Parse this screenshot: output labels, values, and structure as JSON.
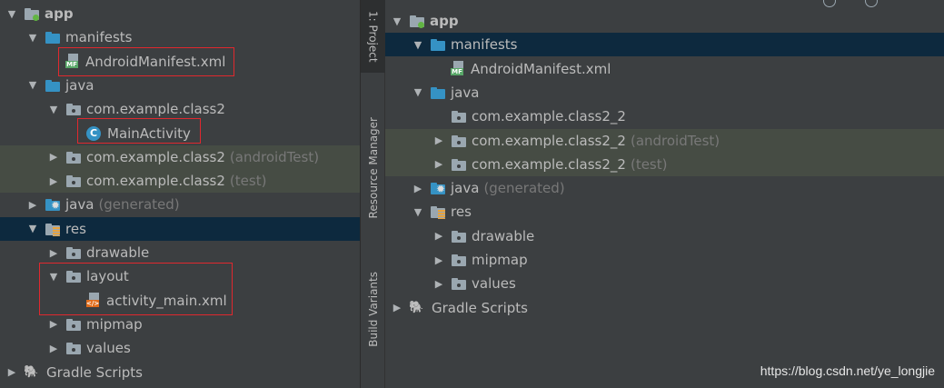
{
  "left_tree": [
    {
      "label": "app",
      "bold": true,
      "icon": "module-icon",
      "arrow": "down",
      "indent": 0,
      "hl": ""
    },
    {
      "label": "manifests",
      "icon": "folder-blue-icon",
      "arrow": "down",
      "indent": 1,
      "hl": ""
    },
    {
      "label": "AndroidManifest.xml",
      "icon": "manifest-file-icon",
      "arrow": "none",
      "indent": 2,
      "hl": ""
    },
    {
      "label": "java",
      "icon": "folder-blue-icon",
      "arrow": "down",
      "indent": 1,
      "hl": ""
    },
    {
      "label": "com.example.class2",
      "icon": "package-icon",
      "arrow": "down",
      "indent": 2,
      "hl": ""
    },
    {
      "label": "MainActivity",
      "icon": "class-icon",
      "arrow": "none",
      "indent": 3,
      "hl": ""
    },
    {
      "label": "com.example.class2",
      "suffix": "(androidTest)",
      "icon": "package-icon",
      "arrow": "right",
      "indent": 2,
      "hl": "green"
    },
    {
      "label": "com.example.class2",
      "suffix": "(test)",
      "icon": "package-icon",
      "arrow": "right",
      "indent": 2,
      "hl": "green"
    },
    {
      "label": "java",
      "suffix": "(generated)",
      "icon": "generated-folder-icon",
      "arrow": "right",
      "indent": 1,
      "hl": ""
    },
    {
      "label": "res",
      "icon": "res-folder-icon",
      "arrow": "down",
      "indent": 1,
      "hl": "blue"
    },
    {
      "label": "drawable",
      "icon": "package-icon",
      "arrow": "right",
      "indent": 2,
      "hl": ""
    },
    {
      "label": "layout",
      "icon": "package-icon",
      "arrow": "down",
      "indent": 2,
      "hl": ""
    },
    {
      "label": "activity_main.xml",
      "icon": "layout-file-icon",
      "arrow": "none",
      "indent": 3,
      "hl": ""
    },
    {
      "label": "mipmap",
      "icon": "package-icon",
      "arrow": "right",
      "indent": 2,
      "hl": ""
    },
    {
      "label": "values",
      "icon": "package-icon",
      "arrow": "right",
      "indent": 2,
      "hl": ""
    },
    {
      "label": "Gradle Scripts",
      "icon": "gradle-icon",
      "arrow": "right",
      "indent": 0,
      "hl": ""
    }
  ],
  "right_tree": [
    {
      "label": "app",
      "bold": true,
      "icon": "module-icon",
      "arrow": "down",
      "indent": 0,
      "hl": ""
    },
    {
      "label": "manifests",
      "icon": "folder-blue-icon",
      "arrow": "down",
      "indent": 1,
      "hl": "blue"
    },
    {
      "label": "AndroidManifest.xml",
      "icon": "manifest-file-icon",
      "arrow": "none",
      "indent": 2,
      "hl": ""
    },
    {
      "label": "java",
      "icon": "folder-blue-icon",
      "arrow": "down",
      "indent": 1,
      "hl": ""
    },
    {
      "label": "com.example.class2_2",
      "icon": "package-icon",
      "arrow": "none",
      "indent": 2,
      "hl": ""
    },
    {
      "label": "com.example.class2_2",
      "suffix": "(androidTest)",
      "icon": "package-icon",
      "arrow": "right",
      "indent": 2,
      "hl": "green"
    },
    {
      "label": "com.example.class2_2",
      "suffix": "(test)",
      "icon": "package-icon",
      "arrow": "right",
      "indent": 2,
      "hl": "green"
    },
    {
      "label": "java",
      "suffix": "(generated)",
      "icon": "generated-folder-icon",
      "arrow": "right",
      "indent": 1,
      "hl": ""
    },
    {
      "label": "res",
      "icon": "res-folder-icon",
      "arrow": "down",
      "indent": 1,
      "hl": ""
    },
    {
      "label": "drawable",
      "icon": "package-icon",
      "arrow": "right",
      "indent": 2,
      "hl": ""
    },
    {
      "label": "mipmap",
      "icon": "package-icon",
      "arrow": "right",
      "indent": 2,
      "hl": ""
    },
    {
      "label": "values",
      "icon": "package-icon",
      "arrow": "right",
      "indent": 2,
      "hl": ""
    },
    {
      "label": "Gradle Scripts",
      "icon": "gradle-icon",
      "arrow": "right",
      "indent": 0,
      "hl": ""
    }
  ],
  "side_tabs": {
    "project": "1: Project",
    "resource_manager": "Resource Manager",
    "build_variants": "Build Variants"
  },
  "watermark": "https://blog.csdn.net/ye_longjie",
  "colors": {
    "background": "#3c3f41",
    "selection_blue": "#0d293e",
    "test_green": "#464c44",
    "annotation_red": "#e0282e",
    "folder_blue": "#3592c4"
  }
}
